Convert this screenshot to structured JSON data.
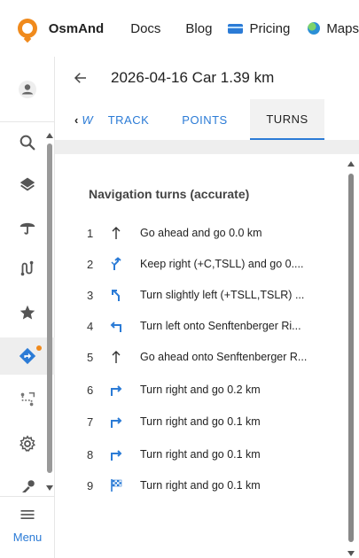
{
  "topnav": {
    "brand": "OsmAnd",
    "links": [
      "Docs",
      "Blog",
      "Pricing",
      "Maps"
    ]
  },
  "sidebar": {
    "items": [
      "avatar",
      "search-icon",
      "layers-icon",
      "weather-icon",
      "routes-icon",
      "favorites-icon",
      "navigation-icon",
      "plan-route-icon",
      "settings-icon",
      "tools-icon"
    ],
    "active_item": "navigation-icon",
    "menu_label": "Menu"
  },
  "header": {
    "title": "2026-04-16 Car 1.39 km"
  },
  "tabs": {
    "scroll_label": "W",
    "items": [
      "TRACK",
      "POINTS",
      "TURNS"
    ],
    "active": "TURNS"
  },
  "turns": {
    "section_title": "Navigation turns (accurate)",
    "items": [
      {
        "num": "1",
        "icon": "straight-arrow-icon",
        "text": "Go ahead and go 0.0 km"
      },
      {
        "num": "2",
        "icon": "keep-right-icon",
        "text": "Keep right (+C,TSLL) and go 0...."
      },
      {
        "num": "3",
        "icon": "slight-left-icon",
        "text": "Turn slightly left (+TSLL,TSLR) ..."
      },
      {
        "num": "4",
        "icon": "turn-left-icon",
        "text": "Turn left onto Senftenberger Ri..."
      },
      {
        "num": "5",
        "icon": "straight-arrow-icon",
        "text": "Go ahead onto Senftenberger R..."
      },
      {
        "num": "6",
        "icon": "turn-right-icon",
        "text": "Turn right and go 0.2 km"
      },
      {
        "num": "7",
        "icon": "turn-right-icon",
        "text": "Turn right and go 0.1 km"
      },
      {
        "num": "8",
        "icon": "turn-right-icon",
        "text": "Turn right and go 0.1 km"
      },
      {
        "num": "9",
        "icon": "finish-flag-icon",
        "text": "Turn right and go 0.1 km"
      }
    ]
  },
  "colors": {
    "accent": "#2b7bd6",
    "brand_orange": "#f08a1c"
  }
}
